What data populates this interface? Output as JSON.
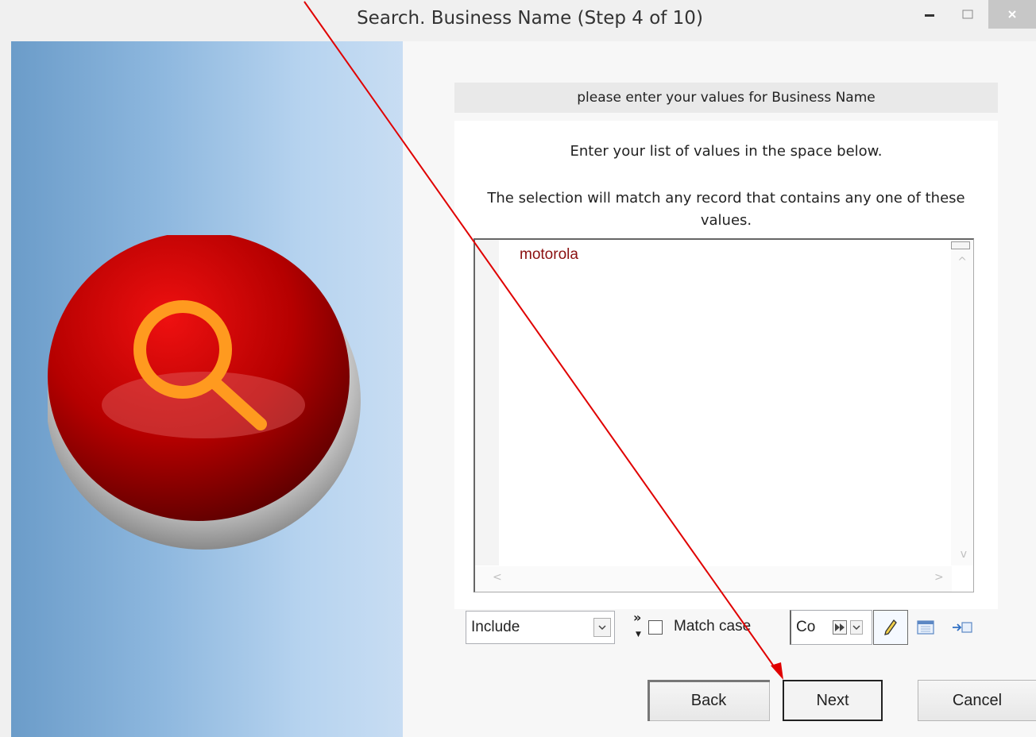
{
  "window": {
    "title": "Search.  Business Name (Step 4 of 10)",
    "controls": [
      "minimize-icon",
      "maximize-icon",
      "close-icon"
    ]
  },
  "header": {
    "prompt": "please enter your values for Business Name"
  },
  "instructions": {
    "line1": "Enter your list of values in the space below.",
    "line2": "The selection will match any record that contains any one of these values."
  },
  "values_list": [
    "motorola"
  ],
  "options": {
    "mode_selected": "Include",
    "match_case_label": "Match case",
    "match_case_checked": false,
    "operator_value": "Co"
  },
  "buttons": {
    "back": "Back",
    "next": "Next",
    "cancel": "Cancel"
  },
  "colors": {
    "value_text": "#8b1010",
    "orb_red": "#c00000",
    "magnifier": "#ff9a1f",
    "annotation_arrow": "#e00000"
  },
  "icons": [
    "search-icon",
    "double-chevron-icon",
    "fast-forward-icon",
    "pencil-icon",
    "calendar-icon",
    "import-icon"
  ]
}
